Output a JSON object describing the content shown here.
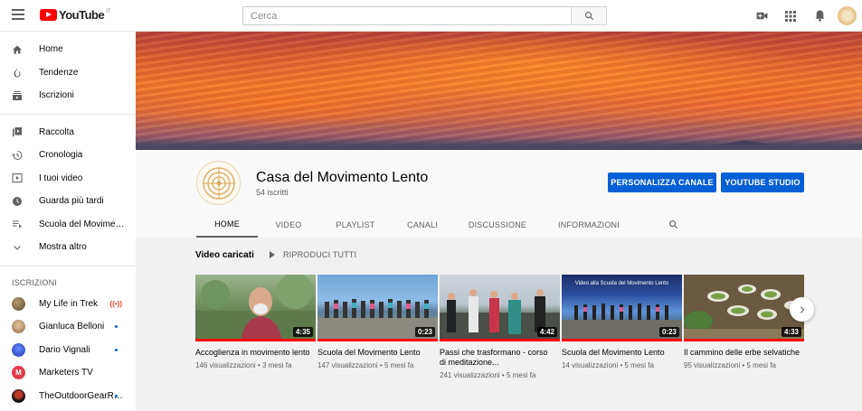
{
  "topbar": {
    "logo_text": "YouTube",
    "logo_region": "IT",
    "search_placeholder": "Cerca"
  },
  "sidebar": {
    "main": [
      {
        "label": "Home",
        "icon": "home-icon"
      },
      {
        "label": "Tendenze",
        "icon": "flame-icon"
      },
      {
        "label": "Iscrizioni",
        "icon": "subscriptions-icon"
      }
    ],
    "library": [
      {
        "label": "Raccolta",
        "icon": "library-icon"
      },
      {
        "label": "Cronologia",
        "icon": "history-icon"
      },
      {
        "label": "I tuoi video",
        "icon": "your-videos-icon"
      },
      {
        "label": "Guarda più tardi",
        "icon": "watch-later-icon"
      },
      {
        "label": "Scuola del Movimento Lento",
        "icon": "playlist-icon"
      },
      {
        "label": "Mostra altro",
        "icon": "chevron-down-icon"
      }
    ],
    "subs_heading": "ISCRIZIONI",
    "subscriptions": [
      {
        "label": "My Life in Trek",
        "badge": "live",
        "color": "#7a6a4a"
      },
      {
        "label": "Gianluca Belloni",
        "badge": "dot",
        "color": "#c9a27a"
      },
      {
        "label": "Dario Vignali",
        "badge": "dot",
        "color": "#2a4fd0"
      },
      {
        "label": "Marketers TV",
        "badge": "",
        "color": "#e23b4b"
      },
      {
        "label": "TheOutdoorGearReview",
        "badge": "dot",
        "color": "#222222"
      }
    ]
  },
  "channel": {
    "name": "Casa del Movimento Lento",
    "subscribers": "54 iscritti",
    "customize_label": "PERSONALIZZA CANALE",
    "studio_label": "YOUTUBE STUDIO",
    "tabs": [
      "HOME",
      "VIDEO",
      "PLAYLIST",
      "CANALI",
      "DISCUSSIONE",
      "INFORMAZIONI"
    ],
    "active_tab": "HOME"
  },
  "shelf": {
    "title": "Video caricati",
    "play_all": "RIPRODUCI TUTTI",
    "videos": [
      {
        "title": "Accoglienza in movimento lento",
        "meta": "146 visualizzazioni • 3 mesi fa",
        "duration": "4:35"
      },
      {
        "title": "Scuola del Movimento Lento",
        "meta": "147 visualizzazioni • 5 mesi fa",
        "duration": "0:23"
      },
      {
        "title": "Passi che trasformano - corso di meditazione...",
        "meta": "241 visualizzazioni • 5 mesi fa",
        "duration": "4:42"
      },
      {
        "title": "Scuola del Movimento Lento",
        "meta": "14 visualizzazioni • 5 mesi fa",
        "duration": "0:23",
        "thumb_text": "Video alla Scuola del Movimento Lento"
      },
      {
        "title": "Il cammino delle erbe selvatiche",
        "meta": "95 visualizzazioni • 5 mesi fa",
        "duration": "4:33"
      }
    ]
  },
  "colors": {
    "accent": "#065fd4",
    "brand_red": "#ff0000"
  }
}
